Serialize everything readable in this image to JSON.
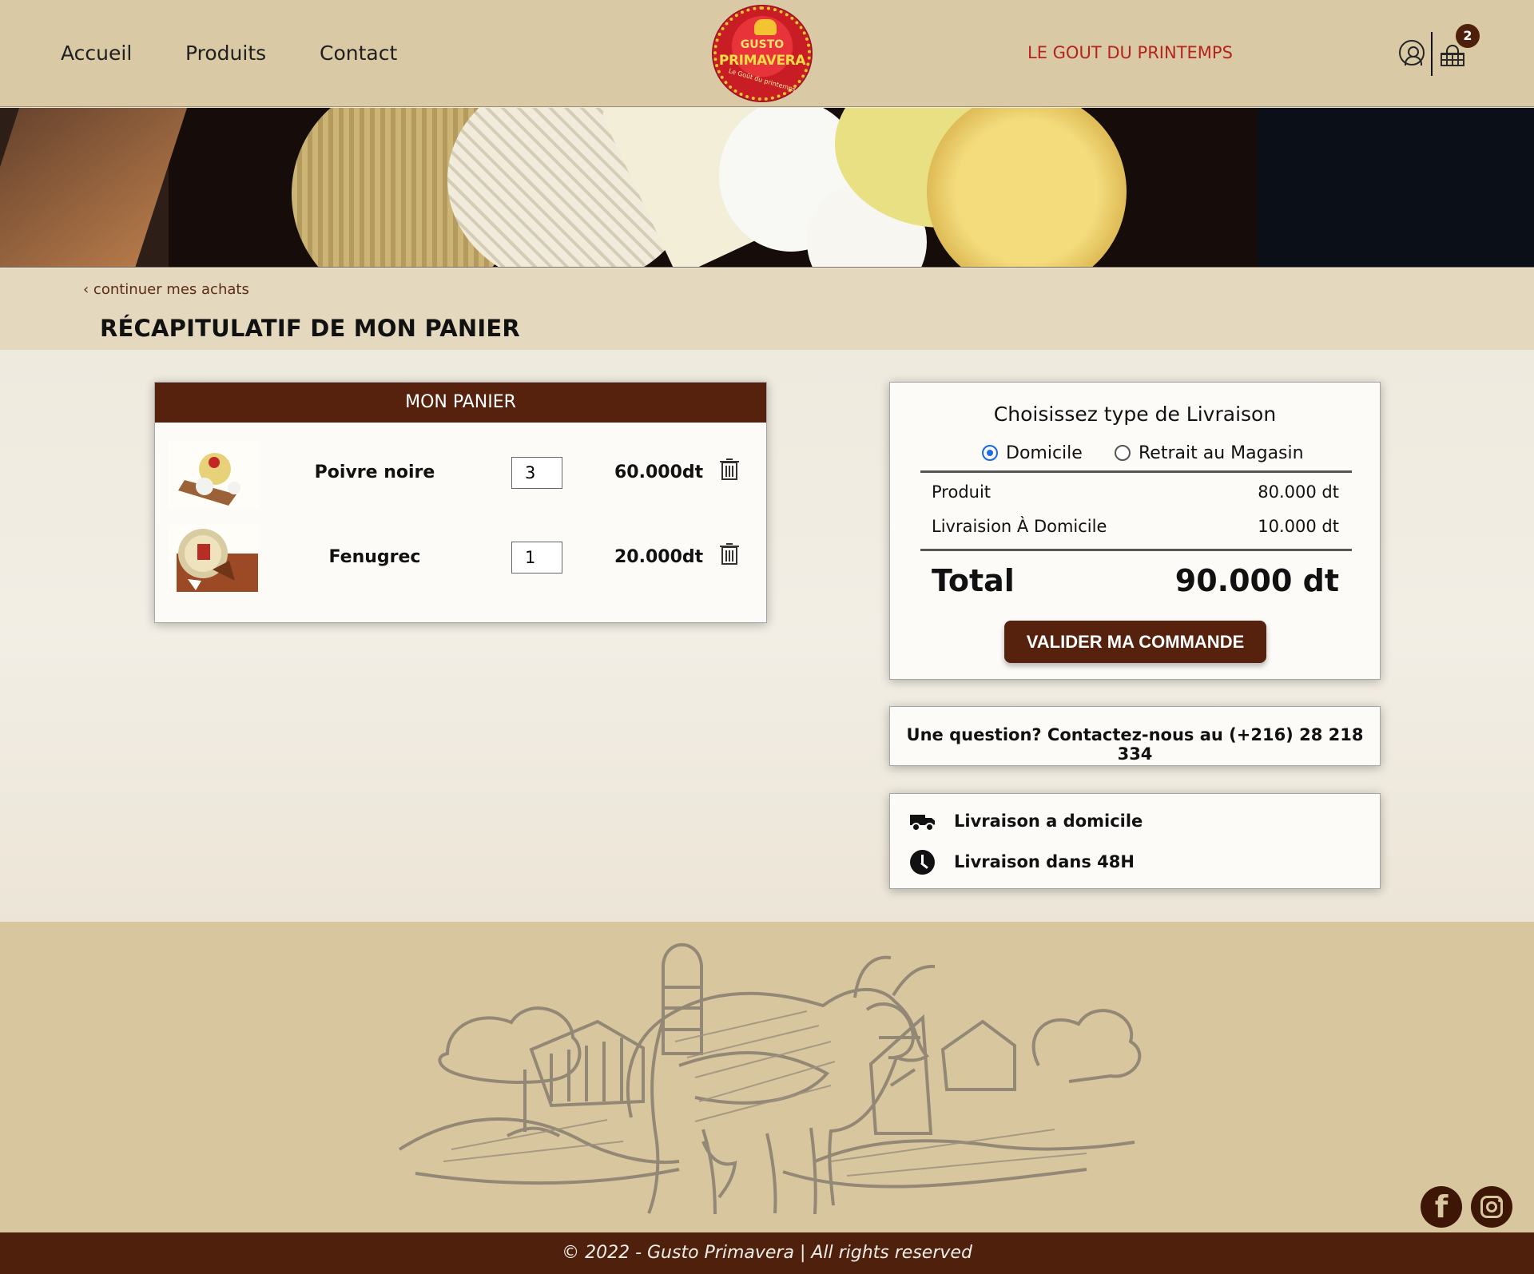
{
  "header": {
    "nav": [
      "Accueil",
      "Produits",
      "Contact"
    ],
    "brand_small": "GUSTO",
    "brand_main": "PRIMAVERA",
    "brand_motto": "Le Goût du printemps",
    "tagline": "LE GOUT DU PRINTEMPS",
    "cart_count": "2"
  },
  "breadcrumb": {
    "back": "continuer mes achats",
    "title": "RÉCAPITULATIF DE MON PANIER"
  },
  "cart": {
    "header": "MON PANIER",
    "items": [
      {
        "name": "Poivre noire",
        "qty": "3",
        "price": "60.000dt"
      },
      {
        "name": "Fenugrec",
        "qty": "1",
        "price": "20.000dt"
      }
    ]
  },
  "summary": {
    "title": "Choisissez type de Livraison",
    "options": [
      "Domicile",
      "Retrait au Magasin"
    ],
    "selected": "Domicile",
    "product_label": "Produit",
    "product_value": "80.000 dt",
    "delivery_label": "Livraision À Domicile",
    "delivery_value": "10.000 dt",
    "total_label": "Total",
    "total_value": "90.000 dt",
    "button": "VALIDER MA COMMANDE"
  },
  "contact": {
    "text": "Une question? Contactez-nous au (+216) 28 218 334"
  },
  "delivery_info": [
    {
      "icon": "truck-icon",
      "text": "Livraison a domicile"
    },
    {
      "icon": "clock-icon",
      "text": "Livraison dans 48H"
    }
  ],
  "footer": {
    "copyright": "© 2022 - Gusto Primavera | All rights reserved"
  },
  "colors": {
    "header_bg": "#d9c9a4",
    "brand_brown": "#56220d",
    "accent_red": "#b52321",
    "footer_bg": "#4f210d"
  }
}
